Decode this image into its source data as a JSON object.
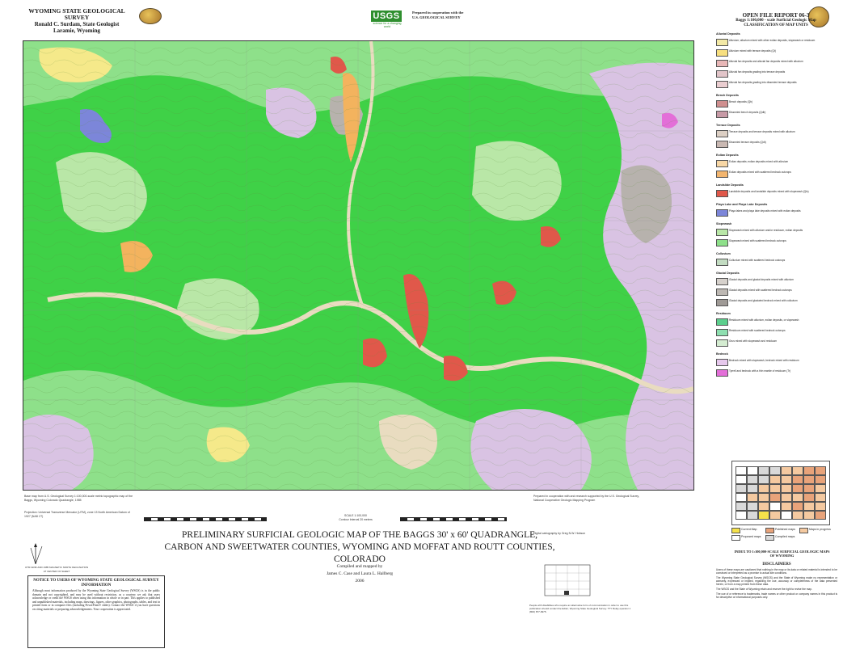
{
  "header": {
    "survey_name": "WYOMING STATE GEOLOGICAL SURVEY",
    "geologist": "Ronald C. Surdam, State Geologist",
    "city": "Laramie, Wyoming",
    "agency": "USGS",
    "agency_tagline": "science for a changing world",
    "cooperation": "Prepared in cooperation with the U.S. GEOLOGICAL SURVEY",
    "report": "OPEN FILE REPORT 06-3",
    "report_sub": "Baggs 1:100,000 - scale Surficial Geologic Map",
    "legend_title": "CLASSIFICATION OF MAP UNITS"
  },
  "title": {
    "line1": "PRELIMINARY SURFICIAL GEOLOGIC MAP OF THE BAGGS 30' x 60' QUADRANGLE,",
    "line2": "CARBON AND SWEETWATER COUNTIES, WYOMING AND MOFFAT AND ROUTT COUNTIES, COLORADO",
    "compiled_label": "Compiled and mapped by",
    "authors": "James C. Case and Laura L. Hallberg",
    "year": "2006"
  },
  "map": {
    "colors": {
      "green": "#3fd147",
      "light_green": "#8ee08a",
      "pale_green": "#b9e7a7",
      "lavender": "#d9c3e3",
      "salmon": "#e0584a",
      "orange": "#f3b35e",
      "yellow": "#f5e98a",
      "tan": "#e9dcc0",
      "blue": "#7c86d9",
      "grey": "#b7b2ad"
    }
  },
  "notice": {
    "title": "NOTICE TO USERS OF WYOMING STATE GEOLOGICAL SURVEY INFORMATION",
    "body": "Although most information produced by the Wyoming State Geological Survey (WSGS) is in the public domain and not copyrighted, and may be used without restriction, as a courtesy we ask that users acknowledge or credit the WSGS when using this information in whole or in part. This applies to published and unpublished materials, including maps, drawings, figures, other graphics, photographs, tables, and text in printed form or in computer files (including PowerPoint® slides). Contact the WSGS if you have questions on citing materials or preparing acknowledgements. Your cooperation is appreciated."
  },
  "legend": {
    "sections": [
      {
        "name": "Alluvial Deposits",
        "items": [
          {
            "color": "#f3e9a6",
            "text": "Alluvium; alluvium mixed with other eolian deposits, slopewash or residuum"
          },
          {
            "color": "#f7df7f",
            "text": "Alluvium mixed with terrace deposits (Qt)"
          },
          {
            "color": "#e8b7b7",
            "text": "Alluvial fan deposits and alluvial fan deposits mixed with alluvium"
          },
          {
            "color": "#e2c5c9",
            "text": "Alluvial fan deposits grading into terrace deposits"
          },
          {
            "color": "#eacdd0",
            "text": "Alluvial fan deposits grading into dissected terrace deposits"
          }
        ]
      },
      {
        "name": "Bench Deposits",
        "items": [
          {
            "color": "#cf8f8f",
            "text": "Bench deposits (Qb)"
          },
          {
            "color": "#c79aa6",
            "text": "Dissected bench deposits (Qdb)"
          }
        ]
      },
      {
        "name": "Terrace Deposits",
        "items": [
          {
            "color": "#dccfc4",
            "text": "Terrace deposits and terrace deposits mixed with alluvium"
          },
          {
            "color": "#c9b8b2",
            "text": "Dissected terrace deposits (Qdt)"
          }
        ]
      },
      {
        "name": "Eolian Deposits",
        "items": [
          {
            "color": "#f8d7a5",
            "text": "Eolian deposits; eolian deposits mixed with alluvium"
          },
          {
            "color": "#f2b56f",
            "text": "Eolian deposits mixed with scattered bedrock outcrops"
          }
        ]
      },
      {
        "name": "Landslide Deposits",
        "items": [
          {
            "color": "#e0584a",
            "text": "Landslide deposits and landslide deposits mixed with slopewash (Qls)"
          }
        ]
      },
      {
        "name": "Playa Lake and Playa Lake Deposits",
        "items": [
          {
            "color": "#7c86d9",
            "text": "Playa lakes and playa lake deposits mixed with eolian deposits"
          }
        ]
      },
      {
        "name": "Slopewash",
        "items": [
          {
            "color": "#b9e7a7",
            "text": "Slopewash mixed with alluvium and/or residuum, eolian deposits"
          },
          {
            "color": "#8ee08a",
            "text": "Slopewash mixed with scattered bedrock outcrops"
          }
        ]
      },
      {
        "name": "Colluvium",
        "items": [
          {
            "color": "#c3dcc2",
            "text": "Colluvium mixed with scattered bedrock outcrops"
          }
        ]
      },
      {
        "name": "Glacial Deposits",
        "items": [
          {
            "color": "#d6d1cc",
            "text": "Glacial deposits and glacial deposits mixed with alluvium"
          },
          {
            "color": "#bdb8b3",
            "text": "Glacial deposits mixed with scattered bedrock outcrops"
          },
          {
            "color": "#9f9a96",
            "text": "Glacial deposits and glaciated bedrock mixed with colluvium"
          }
        ]
      },
      {
        "name": "Residuum",
        "items": [
          {
            "color": "#5ccf8d",
            "text": "Residuum mixed with alluvium, eolian deposits, or slopewash"
          },
          {
            "color": "#8edfb0",
            "text": "Residuum mixed with scattered bedrock outcrops"
          },
          {
            "color": "#d4ecd1",
            "text": "Grus mixed with slopewash and residuum"
          }
        ]
      },
      {
        "name": "Bedrock",
        "items": [
          {
            "color": "#e6c8ec",
            "text": "Bedrock mixed with slopewash, bedrock mixed with residuum"
          },
          {
            "color": "#e36fd8",
            "text": "Tyrrell and bedrock with a thin mantle of residuum (Tr)"
          }
        ]
      }
    ]
  },
  "index_map": {
    "title": "INDEX TO 1:100,000-SCALE SURFICIAL GEOLOGIC MAPS OF WYOMING",
    "legend": [
      "Current Map",
      "Published maps",
      "Maps in progress",
      "Proposed maps",
      "Compiled maps"
    ]
  },
  "disclaimers": {
    "title": "DISCLAIMERS",
    "p1": "Users of these maps are cautioned that nothing in the map or its data or related material is intended to be construed or interpreted as a promise to actual site conditions.",
    "p2": "The Wyoming State Geological Survey (WSGS) and the State of Wyoming make no representation or warranty, expressed or implied, regarding the use, accuracy or completeness of the data presented herein, or from a map printed from these data.",
    "p3": "The WSGS and the State of Wyoming retain and reserve the right to revise the map.",
    "p4": "The use of or reference to trademarks, trade names or other product or company names in this product is for descriptive or informational purposes only."
  },
  "scale": {
    "label": "SCALE 1:100,000",
    "contour": "Contour Interval 20 meters"
  },
  "credits": {
    "base": "Base map from U.S. Geological Survey 1:100,000-scale metric topographic map of the Baggs, Wyoming Colorado Quadrangle, 1985",
    "projection": "Projection: Universal Transverse Mercator (UTM), zone 13 North American Datum of 1927 (NAD 27)",
    "prepared": "Prepared in cooperation with and research supported by the U.S. Geological Survey, National Cooperative Geologic Mapping Program",
    "digital": "Digital cartography by Greg N.W. Hobson",
    "declination": "UTM GRID AND 1985 MAGNETIC NORTH DECLINATION AT CENTER OF SHEET"
  },
  "contact": {
    "text": "People with disabilities who require an alternative form of communication in order to use this publication should contact the Editor, Wyoming State Geological Survey. TTY Relay operator 1 (800) 877-9975."
  }
}
